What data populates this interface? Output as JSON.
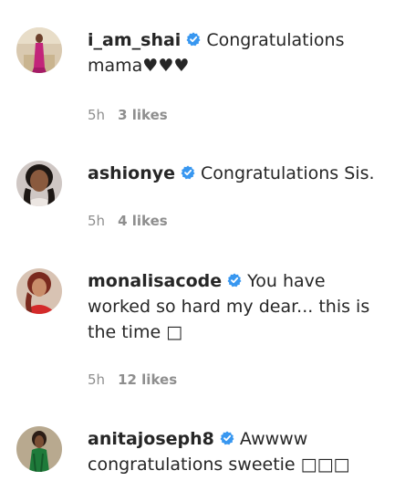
{
  "comments": [
    {
      "username": "i_am_shai",
      "text": "Congratulations mama♥♥♥",
      "time": "5h",
      "likes": "3 likes"
    },
    {
      "username": "ashionye",
      "text": "Congratulations Sis.",
      "time": "5h",
      "likes": "4 likes"
    },
    {
      "username": "monalisacode",
      "text": "You have worked so hard my dear... this is the time □",
      "time": "5h",
      "likes": "12 likes"
    },
    {
      "username": "anitajoseph8",
      "text": "Awwww congratulations sweetie □□□",
      "time": "",
      "likes": ""
    }
  ],
  "colors": {
    "text": "#262626",
    "meta": "#8e8e8e",
    "verified": "#3897f0"
  },
  "icons": {
    "verified": "verified-badge-icon"
  }
}
